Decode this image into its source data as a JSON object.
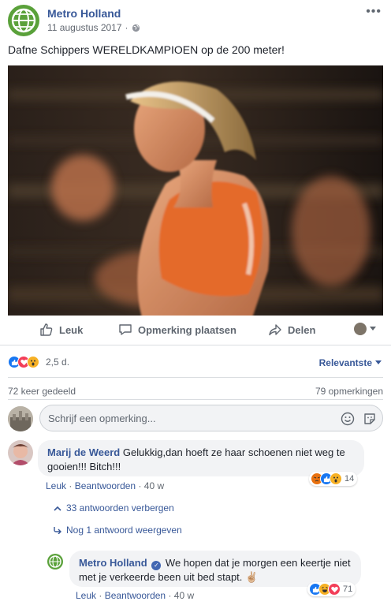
{
  "post": {
    "page_name": "Metro Holland",
    "date": "11 augustus 2017",
    "separator": "·",
    "audience_icon": "globe-icon",
    "more_glyph": "•••",
    "text": "Dafne Schippers WERELDKAMPIOEN op de 200 meter!",
    "photo_subject": "sprinter-photo"
  },
  "actions": {
    "like": "Leuk",
    "comment": "Opmerking plaatsen",
    "share": "Delen"
  },
  "stats": {
    "reactions_count": "2,5 d.",
    "sort_label": "Relevantste",
    "shares": "72 keer gedeeld",
    "comments": "79 opmerkingen"
  },
  "composer": {
    "placeholder": "Schrijf een opmerking..."
  },
  "comments": [
    {
      "author": "Marij de Weerd",
      "text": "Gelukkig,dan hoeft ze haar schoenen niet weg te gooien!!! Bitch!!!",
      "like": "Leuk",
      "reply": "Beantwoorden",
      "age": "40 w",
      "reaction_count": "14",
      "hide_replies": "33 antwoorden verbergen",
      "more_reply": "Nog 1 antwoord weergeven"
    },
    {
      "author": "Metro Holland",
      "text": "We hopen dat je morgen een keertje niet met je verkeerde been uit bed stapt. ✌🏼",
      "like": "Leuk",
      "reply": "Beantwoorden",
      "age": "40 w",
      "reaction_count": "71"
    }
  ],
  "colors": {
    "link": "#385898",
    "like_blue": "#1877f2",
    "love_red": "#f33e58",
    "wow_yellow": "#f7b125",
    "angry_orange": "#e9710f",
    "brand_green": "#5aa13a"
  }
}
